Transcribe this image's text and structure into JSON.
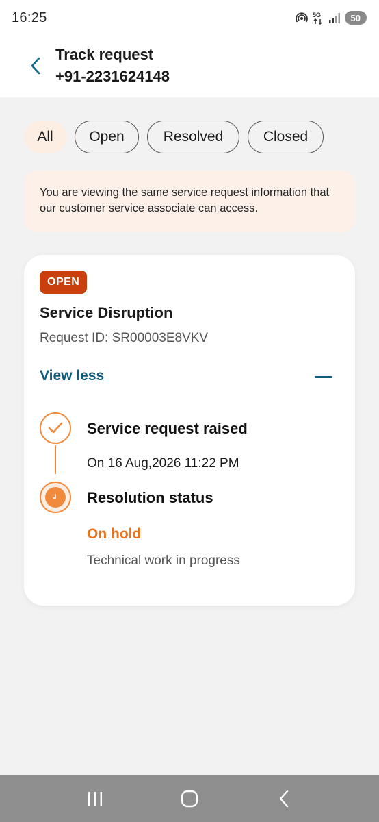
{
  "status_bar": {
    "time": "16:25",
    "battery": "50",
    "icons": [
      "hotspot-icon",
      "5g-icon",
      "signal-icon"
    ]
  },
  "header": {
    "title": "Track request",
    "phone": "+91-2231624148",
    "back_icon": "chevron-left-icon"
  },
  "filters": [
    {
      "label": "All",
      "active": true
    },
    {
      "label": "Open",
      "active": false
    },
    {
      "label": "Resolved",
      "active": false
    },
    {
      "label": "Closed",
      "active": false
    }
  ],
  "info_banner": {
    "text": "You are viewing the same service request information that our customer service associate can access."
  },
  "request_card": {
    "badge": "OPEN",
    "title": "Service Disruption",
    "request_id": "Request ID: SR00003E8VKV",
    "toggle_label": "View less",
    "timeline": [
      {
        "title": "Service request raised",
        "detail": "On 16 Aug,2026 11:22 PM",
        "icon": "checkmark-icon"
      },
      {
        "title": "Resolution status",
        "status": "On hold",
        "detail": "Technical work in progress",
        "icon": "clock-icon"
      }
    ]
  },
  "colors": {
    "accent": "#f08a3c",
    "badge": "#c9400e",
    "link": "#0e5a7c",
    "status_text": "#e8731f"
  },
  "nav_bar": [
    "recent-apps-icon",
    "home-icon",
    "back-icon"
  ]
}
